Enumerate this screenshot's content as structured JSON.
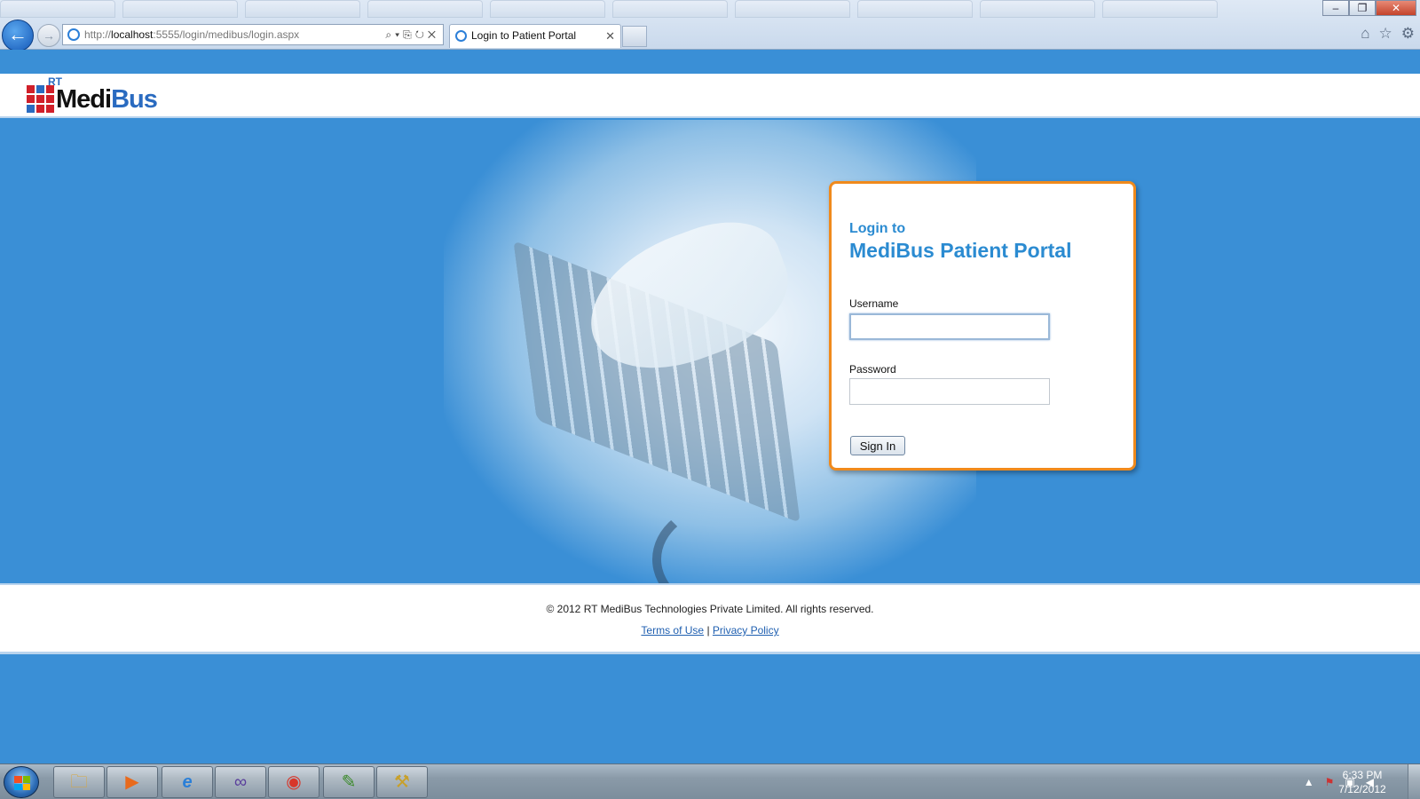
{
  "browser": {
    "url_prefix": "http://",
    "url_host": "localhost",
    "url_rest": ":5555/login/medibus/login.aspx",
    "tab_title": "Login to Patient Portal",
    "tab_close": "✕",
    "back_glyph": "←",
    "forward_glyph": "→",
    "address_tools": "⌕▾⎘↻✕",
    "window_buttons": {
      "minimize": "–",
      "maximize": "❐",
      "close": "✕"
    },
    "right_icons": {
      "home": "⌂",
      "favorites": "☆",
      "tools": "⚙"
    }
  },
  "logo": {
    "rt": "RT",
    "medi": "Medi",
    "bus": "Bus"
  },
  "login": {
    "title_line1": "Login to",
    "title_line2": "MediBus Patient Portal",
    "username_label": "Username",
    "username_value": "",
    "password_label": "Password",
    "password_value": "",
    "signin_label": "Sign In"
  },
  "footer": {
    "copyright": "© 2012 RT MediBus Technologies Private Limited. All rights reserved.",
    "terms": "Terms of Use",
    "separator": "|",
    "privacy": "Privacy Policy"
  },
  "taskbar": {
    "apps": [
      {
        "name": "windows-explorer",
        "glyph": "🗀"
      },
      {
        "name": "media-player",
        "glyph": "▶"
      },
      {
        "name": "internet-explorer",
        "glyph": "e"
      },
      {
        "name": "visual-studio",
        "glyph": "∞"
      },
      {
        "name": "chrome",
        "glyph": "◉"
      },
      {
        "name": "project-app",
        "glyph": "✎"
      },
      {
        "name": "tools-app",
        "glyph": "⚒"
      }
    ],
    "tray_icons": {
      "expand": "▲",
      "action_center": "⚑",
      "network": "▣",
      "volume": "◀"
    },
    "time": "6:33 PM",
    "date": "7/12/2012"
  },
  "colors": {
    "page_blue": "#3a8fd6",
    "card_border": "#f08a1c",
    "title_blue": "#2b8bd1",
    "logo_red": "#d0202a",
    "logo_blue": "#2a6bc0"
  }
}
